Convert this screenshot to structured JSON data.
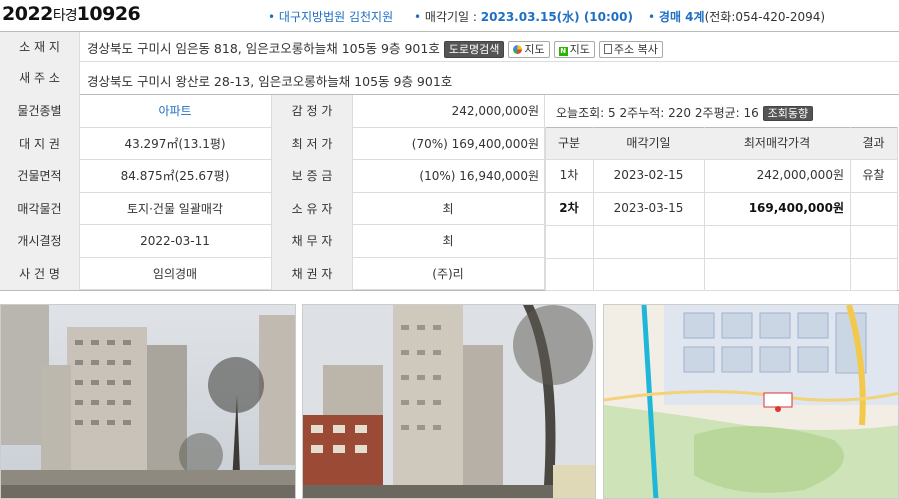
{
  "header": {
    "case_year": "2022",
    "case_type": "타경",
    "case_number": "10926",
    "court": "대구지방법원 김천지원",
    "sale_date_label": "매각기일 :",
    "sale_date": "2023.03.15(水) (10:00)",
    "department": "경매 4계",
    "phone": "(전화:054-420-2094)"
  },
  "address": {
    "location_label": "소 재 지",
    "location": "경상북도 구미시 임은동 818, 임은코오롱하늘채 105동 9층 901호",
    "road_search_btn": "도로명검색",
    "map1_btn": "지도",
    "map2_btn": "지도",
    "copy_btn": "주소 복사",
    "new_addr_label": "새 주 소",
    "new_addr": "경상북도 구미시 왕산로 28-13, 임은코오롱하늘채 105동 9층 901호"
  },
  "info": [
    {
      "label": "물건종별",
      "value": "아파트",
      "label2": "감 정 가",
      "value2": "242,000,000원"
    },
    {
      "label": "대 지 권",
      "value": "43.297㎡(13.1평)",
      "label2": "최 저 가",
      "value2": "(70%) 169,400,000원"
    },
    {
      "label": "건물면적",
      "value": "84.875㎡(25.67평)",
      "label2": "보 증 금",
      "value2": "(10%) 16,940,000원"
    },
    {
      "label": "매각물건",
      "value": "토지·건물 일괄매각",
      "label2": "소 유 자",
      "value2": "최"
    },
    {
      "label": "개시결정",
      "value": "2022-03-11",
      "label2": "채 무 자",
      "value2": "최"
    },
    {
      "label": "사 건 명",
      "value": "임의경매",
      "label2": "채 권 자",
      "value2": "(주)리"
    }
  ],
  "views": {
    "today_label": "오늘조회:",
    "today": "5",
    "two_week_label": "2주누적:",
    "two_week": "220",
    "avg_label": "2주평균:",
    "avg": "16",
    "trend_btn": "조회동향"
  },
  "history": {
    "headers": [
      "구분",
      "매각기일",
      "최저매각가격",
      "결과"
    ],
    "rows": [
      {
        "round": "1차",
        "date": "2023-02-15",
        "price": "242,000,000원",
        "result": "유찰"
      },
      {
        "round": "2차",
        "date": "2023-03-15",
        "price": "169,400,000원",
        "result": ""
      }
    ]
  }
}
